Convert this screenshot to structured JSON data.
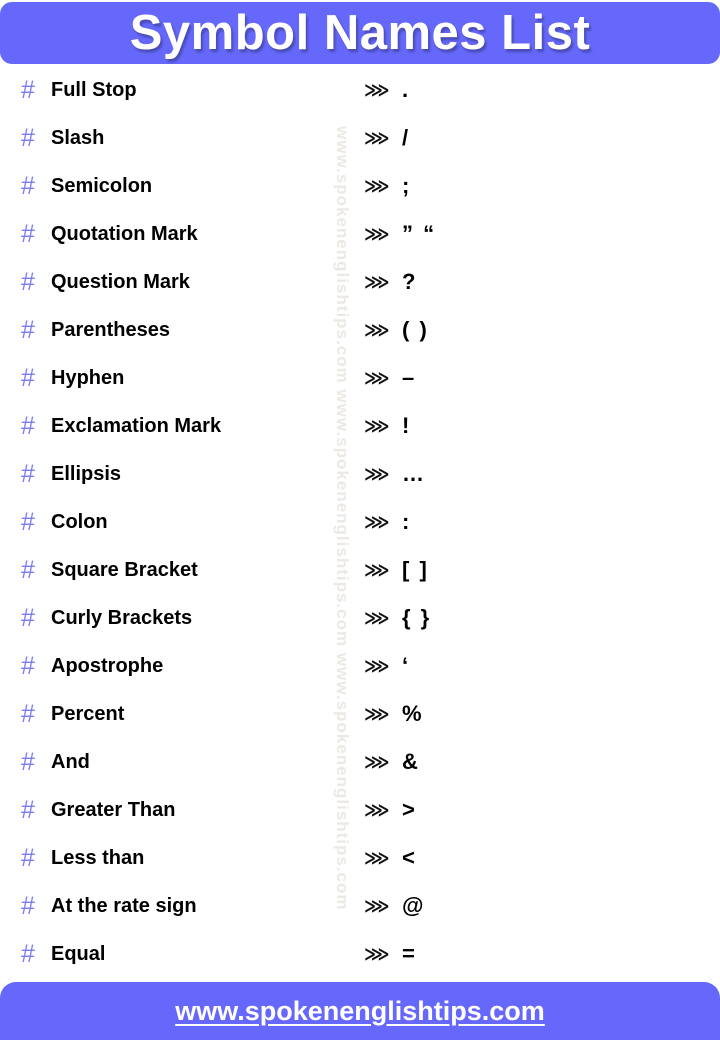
{
  "header": {
    "title": "Symbol Names List",
    "background_color": "#6568fa",
    "text_color": "#ffffff"
  },
  "watermark": {
    "text": "www.spokenenglishtips.com www.spokenenglishtips.com www.spokenenglishtips.com",
    "color": "#ece9e4"
  },
  "list": {
    "bullet_glyph": "#",
    "bullet_color": "#7b7df6",
    "separator_glyph": "⋙",
    "rows": [
      {
        "name": "Full Stop",
        "symbol": "."
      },
      {
        "name": "Slash",
        "symbol": "/"
      },
      {
        "name": "Semicolon",
        "symbol": ";"
      },
      {
        "name": "Quotation Mark",
        "symbol": "” “"
      },
      {
        "name": "Question Mark",
        "symbol": "?"
      },
      {
        "name": "Parentheses",
        "symbol": "( )"
      },
      {
        "name": "Hyphen",
        "symbol": "–"
      },
      {
        "name": "Exclamation Mark",
        "symbol": "!"
      },
      {
        "name": "Ellipsis",
        "symbol": "…"
      },
      {
        "name": "Colon",
        "symbol": ":"
      },
      {
        "name": "Square Bracket",
        "symbol": "[ ]"
      },
      {
        "name": "Curly Brackets",
        "symbol": "{ }"
      },
      {
        "name": "Apostrophe",
        "symbol": "‘"
      },
      {
        "name": "Percent",
        "symbol": "%"
      },
      {
        "name": "And",
        "symbol": "&"
      },
      {
        "name": "Greater Than",
        "symbol": ">"
      },
      {
        "name": "Less than",
        "symbol": "<"
      },
      {
        "name": "At the rate sign",
        "symbol": "@"
      },
      {
        "name": "Equal",
        "symbol": "="
      }
    ]
  },
  "footer": {
    "url": "www.spokenenglishtips.com",
    "background_color": "#6568fa",
    "text_color": "#ffffff"
  }
}
